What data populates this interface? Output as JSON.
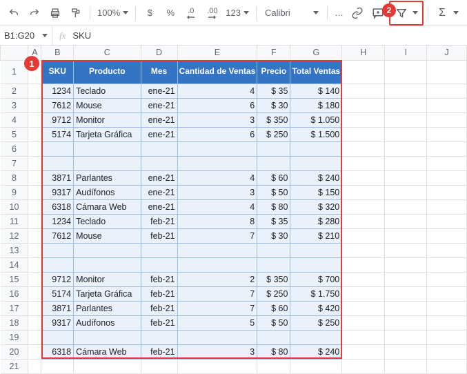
{
  "toolbar": {
    "zoom": "100%",
    "format_more": "123",
    "font": "Calibri",
    "decimal_dec": ".0",
    "decimal_inc": ".00"
  },
  "badges": {
    "one": "1",
    "two": "2"
  },
  "namebox": {
    "ref": "B1:G20"
  },
  "formula_bar": {
    "value": "SKU"
  },
  "columns": [
    "A",
    "B",
    "C",
    "D",
    "E",
    "F",
    "G",
    "H",
    "I",
    "J"
  ],
  "headers": {
    "sku": "SKU",
    "producto": "Producto",
    "mes": "Mes",
    "cantidad": "Cantidad de Ventas",
    "precio": "Precio",
    "total": "Total Ventas"
  },
  "rows": [
    {
      "n": "1"
    },
    {
      "n": "2",
      "sku": "1234",
      "producto": "Teclado",
      "mes": "ene-21",
      "cant": "4",
      "precio": "$ 35",
      "total": "$ 140"
    },
    {
      "n": "3",
      "sku": "7612",
      "producto": "Mouse",
      "mes": "ene-21",
      "cant": "6",
      "precio": "$ 30",
      "total": "$ 180"
    },
    {
      "n": "4",
      "sku": "9712",
      "producto": "Monitor",
      "mes": "ene-21",
      "cant": "3",
      "precio": "$ 350",
      "total": "$ 1.050"
    },
    {
      "n": "5",
      "sku": "5174",
      "producto": "Tarjeta Gráfica",
      "mes": "ene-21",
      "cant": "6",
      "precio": "$ 250",
      "total": "$ 1.500"
    },
    {
      "n": "6",
      "blank": true
    },
    {
      "n": "7",
      "blank": true
    },
    {
      "n": "8",
      "sku": "3871",
      "producto": "Parlantes",
      "mes": "ene-21",
      "cant": "4",
      "precio": "$ 60",
      "total": "$ 240"
    },
    {
      "n": "9",
      "sku": "9317",
      "producto": "Audífonos",
      "mes": "ene-21",
      "cant": "3",
      "precio": "$ 50",
      "total": "$ 150"
    },
    {
      "n": "10",
      "sku": "6318",
      "producto": "Cámara Web",
      "mes": "ene-21",
      "cant": "4",
      "precio": "$ 80",
      "total": "$ 320"
    },
    {
      "n": "11",
      "sku": "1234",
      "producto": "Teclado",
      "mes": "feb-21",
      "cant": "8",
      "precio": "$ 35",
      "total": "$ 280"
    },
    {
      "n": "12",
      "sku": "7612",
      "producto": "Mouse",
      "mes": "feb-21",
      "cant": "7",
      "precio": "$ 30",
      "total": "$ 210"
    },
    {
      "n": "13",
      "blank": true
    },
    {
      "n": "14",
      "blank": true
    },
    {
      "n": "15",
      "sku": "9712",
      "producto": "Monitor",
      "mes": "feb-21",
      "cant": "2",
      "precio": "$ 350",
      "total": "$ 700"
    },
    {
      "n": "16",
      "sku": "5174",
      "producto": "Tarjeta Gráfica",
      "mes": "feb-21",
      "cant": "7",
      "precio": "$ 250",
      "total": "$ 1.750"
    },
    {
      "n": "17",
      "sku": "3871",
      "producto": "Parlantes",
      "mes": "feb-21",
      "cant": "7",
      "precio": "$ 60",
      "total": "$ 420"
    },
    {
      "n": "18",
      "sku": "9317",
      "producto": "Audífonos",
      "mes": "feb-21",
      "cant": "5",
      "precio": "$ 50",
      "total": "$ 250"
    },
    {
      "n": "19",
      "blank": true
    },
    {
      "n": "20",
      "sku": "6318",
      "producto": "Cámara Web",
      "mes": "feb-21",
      "cant": "3",
      "precio": "$ 80",
      "total": "$ 240"
    },
    {
      "n": "21"
    }
  ]
}
